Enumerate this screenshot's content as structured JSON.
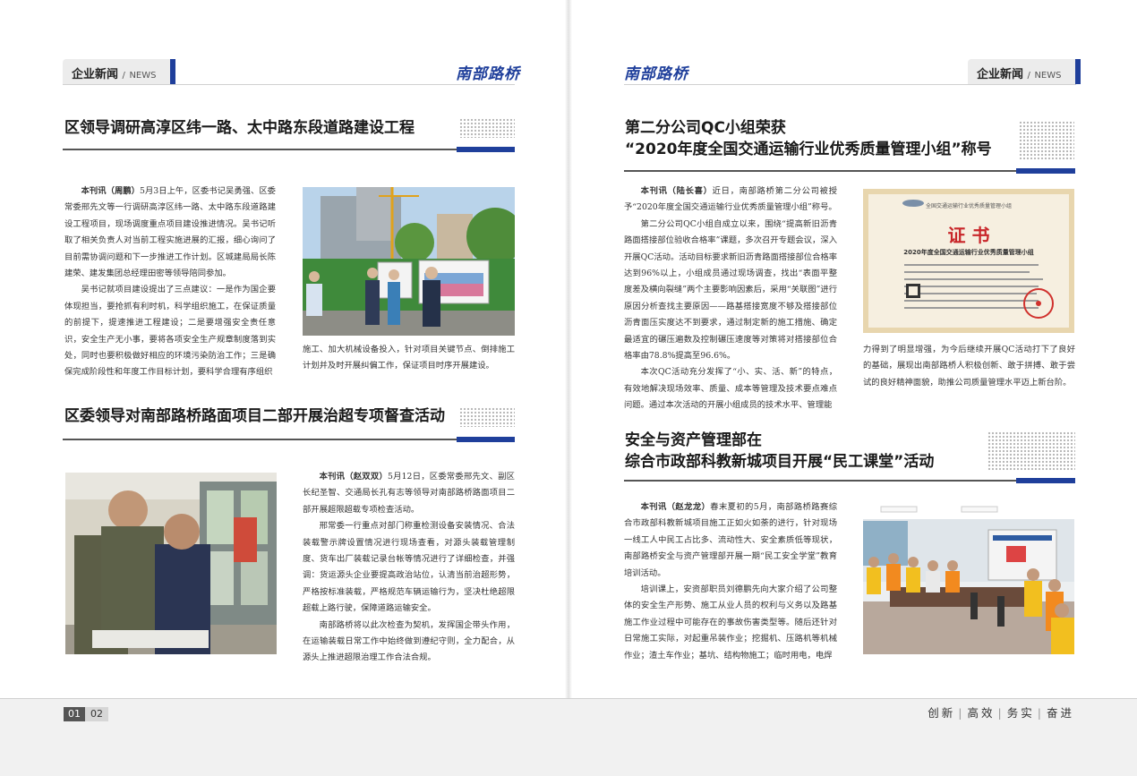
{
  "brand": "南部路桥",
  "section": {
    "cn": "企业新闻",
    "slash": "/",
    "en": "NEWS"
  },
  "left": {
    "article1": {
      "title": "区领导调研高淳区纬一路、太中路东段道路建设工程",
      "byline": "本刊讯（周鹏）",
      "p1": "5月3日上午，区委书记吴勇强、区委常委邢先文等一行调研高淳区纬一路、太中路东段道路建设工程项目，现场调度重点项目建设推进情况。吴书记听取了相关负责人对当前工程实施进展的汇报，细心询问了目前需协调问题和下一步推进工作计划。区城建局局长陈建荣、建发集团总经理田密等领导陪同参加。",
      "p2": "吴书记就项目建设提出了三点建议：一是作为国企要体现担当，要抢抓有利时机，科学组织施工，在保证质量的前提下，提速推进工程建设；二是要增强安全责任意识，安全生产无小事，要将各项安全生产规章制度落到实处，同时也要积极做好相应的环境污染防治工作；三是确保完成阶段性和年度工作目标计划，要科学合理有序组织",
      "p2_cont": "施工、加大机械设备投入，针对项目关键节点、倒排施工计划并及时开展纠偏工作，保证项目时序开展建设。"
    },
    "article2": {
      "title": "区委领导对南部路桥路面项目二部开展治超专项督查活动",
      "byline": "本刊讯（赵双双）",
      "p1": "5月12日，区委常委邢先文、副区长纪圣智、交通局长孔有志等领导对南部路桥路面项目二部开展超限超载专项检查活动。",
      "p2": "邢常委一行重点对部门称重检测设备安装情况、合法装载警示牌设置情况进行现场查看，对源头装载管理制度、货车出厂装载记录台帐等情况进行了详细检查，并强调：货运源头企业要提高政治站位，认清当前治超形势，严格按标准装载，严格规范车辆运输行为，坚决杜绝超限超载上路行驶，保障道路运输安全。",
      "p3": "南部路桥将以此次检查为契机，发挥国企带头作用，在运输装载日常工作中始终做到遵纪守则，全力配合，从源头上推进超限治理工作合法合规。"
    }
  },
  "right": {
    "article1": {
      "title_line1": "第二分公司QC小组荣获",
      "title_line2": "“2020年度全国交通运输行业优秀质量管理小组”称号",
      "byline": "本刊讯（陆长喜）",
      "p1": "近日，南部路桥第二分公司被授予“2020年度全国交通运输行业优秀质量管理小组”称号。",
      "p2": "第二分公司QC小组自成立以来，围绕“提高新旧沥青路面搭接部位验收合格率”课题，多次召开专题会议，深入开展QC活动。活动目标要求新旧沥青路面搭接部位合格率达到96%以上，小组成员通过现场调查，找出“表面平整度差及横向裂缝”两个主要影响因素后，采用“关联图”进行原因分析查找主要原因——路基搭接宽度不够及搭接部位沥青面压实度达不到要求，通过制定新的施工措施、确定最适宜的碾压遍数及控制碾压速度等对策将对搭接部位合格率由78.8%提高至96.6%。",
      "p3": "本次QC活动充分发挥了“小、实、活、新”的特点，有效地解决现场效率、质量、成本等管理及技术要点难点问题。通过本次活动的开展小组成员的技术水平、管理能",
      "p3_cont": "力得到了明显增强，为今后继续开展QC活动打下了良好的基础，展现出南部路桥人积极创新、敢于拼搏、敢于尝试的良好精神面貌，助推公司质量管理水平迈上新台阶。",
      "cert": {
        "org_line": "全国交通运输行业优秀质量管理小组",
        "big": "证 书",
        "subtitle": "2020年度全国交通运输行业优秀质量管理小组"
      }
    },
    "article2": {
      "title_line1": "安全与资产管理部在",
      "title_line2": "综合市政部科教新城项目开展“民工课堂”活动",
      "byline": "本刊讯（赵龙龙）",
      "p1": "春末夏初的5月，南部路桥路赛综合市政部科教新城项目施工正如火如荼的进行，针对现场一线工人中民工占比多、流动性大、安全素质低等现状，南部路桥安全与资产管理部开展一期“民工安全学堂”教育培训活动。",
      "p2": "培训课上，安资部职员刘德鹏先向大家介绍了公司整体的安全生产形势、施工从业人员的权利与义务以及路基施工作业过程中可能存在的事故伤害类型等。随后还针对日常施工实际，对起重吊装作业；挖掘机、压路机等机械作业；渣土车作业；基坑、结构物施工；临时用电，电焊"
    }
  },
  "footer": {
    "page_left": "01",
    "page_right": "02",
    "slogan": [
      "创新",
      "高效",
      "务实",
      "奋进"
    ],
    "slogan_sep": "|"
  },
  "colors": {
    "brand_blue": "#1f3f9b",
    "tab_gray": "#ececec",
    "rule_gray": "#555555"
  }
}
